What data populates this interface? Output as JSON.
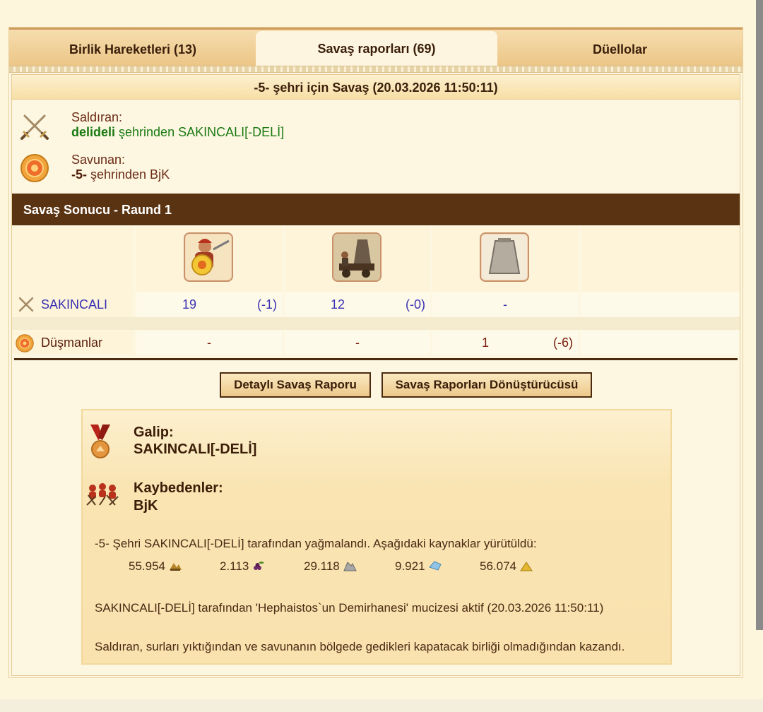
{
  "tabs": [
    {
      "label": "Birlik Hareketleri (13)",
      "active": false
    },
    {
      "label": "Savaş raporları (69)",
      "active": true
    },
    {
      "label": "Düellolar",
      "active": false
    }
  ],
  "report": {
    "title": "-5- şehri için Savaş (20.03.2026 11:50:11)",
    "attacker": {
      "label": "Saldıran:",
      "city": "delideli",
      "from_text": " şehrinden SAKINCALI[-DELİ]"
    },
    "defender": {
      "label": "Savunan:",
      "city": "-5-",
      "from_text": " şehrinden BjK"
    }
  },
  "battle": {
    "title": "Savaş Sonucu - Raund 1",
    "rows": [
      {
        "name": "SAKINCALI",
        "cells": [
          [
            "19",
            "(-1)"
          ],
          [
            "12",
            "(-0)"
          ],
          [
            "-",
            ""
          ]
        ]
      },
      {
        "name": "Düşmanlar",
        "cells": [
          [
            "-",
            ""
          ],
          [
            "-",
            ""
          ],
          [
            "1",
            "(-6)"
          ]
        ]
      }
    ]
  },
  "buttons": {
    "detail": "Detaylı Savaş Raporu",
    "converter": "Savaş Raporları Dönüştürücüsü"
  },
  "summary": {
    "winner_label": "Galip:",
    "winner": "SAKINCALI[-DELİ]",
    "losers_label": "Kaybedenler:",
    "losers": "BjK",
    "pillage_text": "-5- Şehri SAKINCALI[-DELİ] tarafından yağmalandı. Aşağıdaki kaynaklar yürütüldü:",
    "resources": [
      {
        "value": "55.954",
        "icon": "wood-icon"
      },
      {
        "value": "2.113",
        "icon": "wine-icon"
      },
      {
        "value": "29.118",
        "icon": "marble-icon"
      },
      {
        "value": "9.921",
        "icon": "crystal-icon"
      },
      {
        "value": "56.074",
        "icon": "sulfur-icon"
      }
    ],
    "wonder_text": "SAKINCALI[-DELİ] tarafından 'Hephaistos`un Demirhanesi' mucizesi aktif (20.03.2026 11:50:11)",
    "reason_text": "Saldıran, surları yıktığından ve savunanın bölgede gedikleri kapatacak birliği olmadığından kazandı."
  }
}
